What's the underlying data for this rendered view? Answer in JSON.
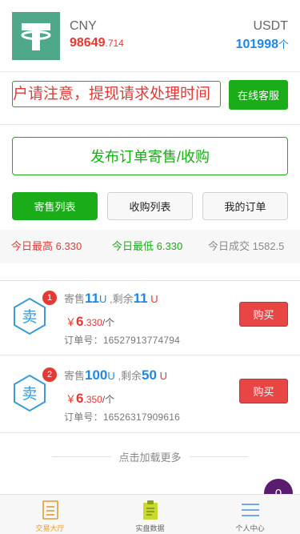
{
  "header": {
    "cny_label": "CNY",
    "cny_int": "98649",
    "cny_dec": ".714",
    "usdt_label": "USDT",
    "usdt_value": "101998",
    "usdt_unit": "个",
    "logo_icon": "tether-icon",
    "logo_color": "#4fa88a"
  },
  "notice": {
    "text": "户请注意，提现请求处理时间",
    "service_label": "在线客服"
  },
  "publish_label": "发布订单寄售/收购",
  "tabs": {
    "sell": "寄售列表",
    "buy": "收购列表",
    "orders": "我的订单"
  },
  "stats": {
    "high_label": "今日最高",
    "high_value": "6.330",
    "low_label": "今日最低",
    "low_value": "6.330",
    "volume_label": "今日成交",
    "volume_value": "1582.5"
  },
  "orders": [
    {
      "badge": "1",
      "icon_char": "卖",
      "consign_label": "寄售",
      "consign_amount": "11",
      "consign_unit": "U",
      "remain_label": ",剩余",
      "remain_amount": "11",
      "remain_unit": "U",
      "yen": "￥",
      "price_int": "6",
      "price_dec": ".330",
      "price_unit": "/个",
      "order_no_label": "订单号：",
      "order_no": "16527913774794",
      "buy_label": "购买"
    },
    {
      "badge": "2",
      "icon_char": "卖",
      "consign_label": "寄售",
      "consign_amount": "100",
      "consign_unit": "U",
      "remain_label": ",剩余",
      "remain_amount": "50",
      "remain_unit": "U",
      "yen": "￥",
      "price_int": "6",
      "price_dec": ".350",
      "price_unit": "/个",
      "order_no_label": "订单号：",
      "order_no": "16526317909616",
      "buy_label": "购买"
    }
  ],
  "load_more": "点击加载更多",
  "float_badge": "0",
  "nav": {
    "trade": "交易大厅",
    "market": "实盘数据",
    "user": "个人中心"
  },
  "colors": {
    "green": "#1aad19",
    "red": "#e53935",
    "blue": "#1e88e5",
    "nav_active": "#e69a2e"
  }
}
